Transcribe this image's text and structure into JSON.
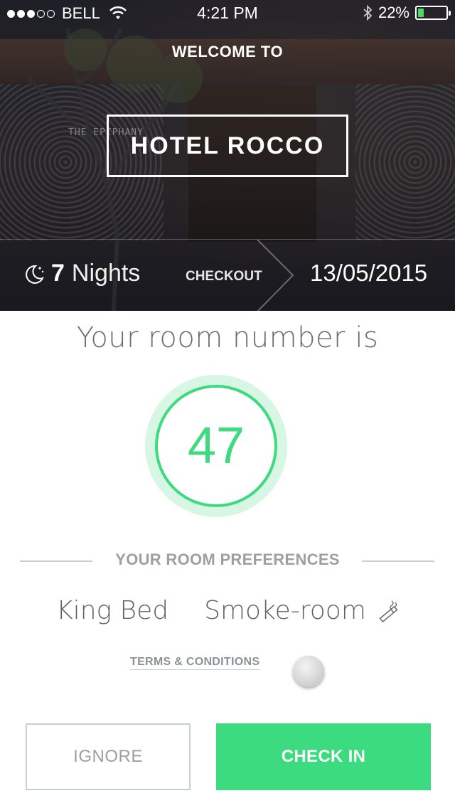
{
  "status_bar": {
    "signal_dots": [
      true,
      true,
      true,
      false,
      false
    ],
    "carrier": "BELL",
    "time": "4:21 PM",
    "battery_percent_label": "22%",
    "battery_level": 0.22,
    "battery_color": "#4cd964"
  },
  "hero": {
    "welcome": "WELCOME TO",
    "hotel_name": "HOTEL ROCCO",
    "sign_text": "THE EPIPHANY"
  },
  "stay": {
    "nights_icon": "moon-stars-icon",
    "nights_count": "7",
    "nights_label": "Nights",
    "checkout_label": "CHECKOUT",
    "checkout_date": "13/05/2015"
  },
  "room": {
    "title": "Your room number is",
    "number": "47",
    "accent_color": "#3ddb80"
  },
  "preferences": {
    "title": "YOUR ROOM PREFERENCES",
    "items": [
      {
        "label": "King Bed"
      },
      {
        "label": "Smoke-room",
        "icon": "cigarette-icon"
      }
    ]
  },
  "terms": {
    "label": "TERMS & CONDITIONS",
    "accepted": false
  },
  "actions": {
    "ignore_label": "IGNORE",
    "checkin_label": "CHECK IN"
  }
}
